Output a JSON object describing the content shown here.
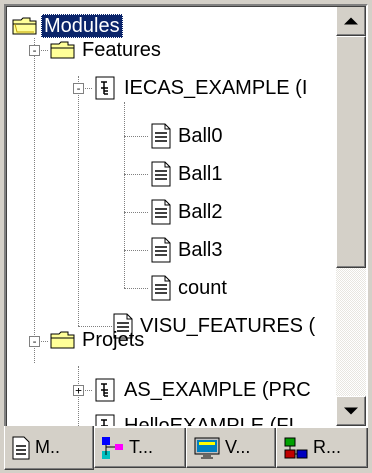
{
  "tree": {
    "root": {
      "label": "Modules",
      "icon": "folder-icon"
    },
    "features": {
      "label": "Features",
      "icon": "folder-icon",
      "toggle": "-"
    },
    "iecas_example": {
      "label": "IECAS_EXAMPLE (I",
      "icon": "program-icon",
      "toggle": "-"
    },
    "ball0": {
      "label": "Ball0",
      "icon": "document-icon"
    },
    "ball1": {
      "label": "Ball1",
      "icon": "document-icon"
    },
    "ball2": {
      "label": "Ball2",
      "icon": "document-icon"
    },
    "ball3": {
      "label": "Ball3",
      "icon": "document-icon"
    },
    "count": {
      "label": "count",
      "icon": "document-icon"
    },
    "visu_features": {
      "label": "VISU_FEATURES (",
      "icon": "document-icon"
    },
    "projets": {
      "label": "Projets",
      "icon": "folder-icon",
      "toggle": "-"
    },
    "as_example": {
      "label": "AS_EXAMPLE (PRC",
      "icon": "program-icon",
      "toggle": "+"
    },
    "partial_item": {
      "label": "HelloEXAMPLE (FI",
      "icon": "program-icon"
    }
  },
  "tabs": [
    {
      "label": "M..",
      "icon": "document-icon",
      "active": true
    },
    {
      "label": "T...",
      "icon": "type-icon",
      "active": false
    },
    {
      "label": "V...",
      "icon": "visualization-icon",
      "active": false
    },
    {
      "label": "R...",
      "icon": "resources-icon",
      "active": false
    }
  ],
  "colors": {
    "selection": "#0a246a",
    "face": "#d4d0c8"
  }
}
